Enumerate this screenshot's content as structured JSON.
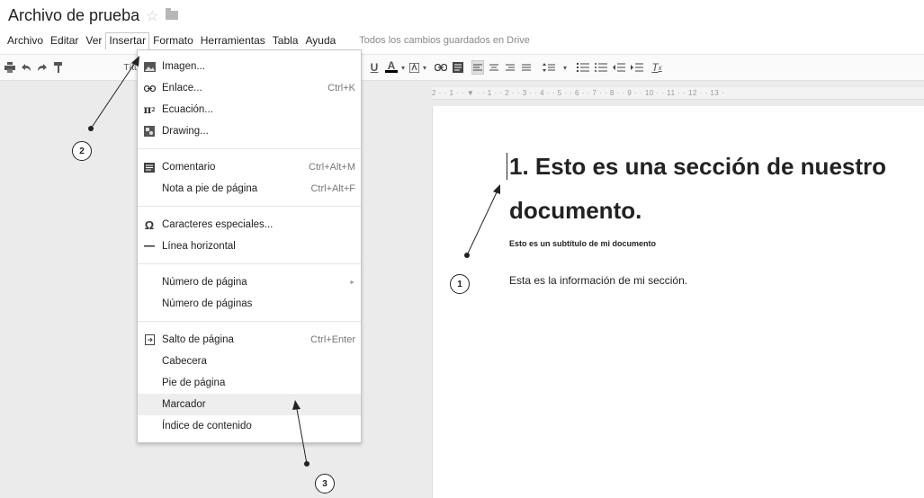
{
  "doc": {
    "title": "Archivo de prueba",
    "star_icon": "star-icon",
    "folder_icon": "folder-icon"
  },
  "menubar": {
    "items": [
      "Archivo",
      "Editar",
      "Ver",
      "Insertar",
      "Formato",
      "Herramientas",
      "Tabla",
      "Ayuda"
    ],
    "active": "Insertar",
    "saved_status": "Todos los cambios guardados en Drive"
  },
  "toolbar": {
    "style_label": "Títu",
    "icons": [
      "print-icon",
      "undo-icon",
      "redo-icon",
      "paint-format-icon",
      "underline-icon",
      "text-color-icon",
      "highlight-icon",
      "link-icon",
      "comment-icon",
      "align-left-icon",
      "align-center-icon",
      "align-right-icon",
      "justify-icon",
      "line-spacing-icon",
      "numbered-list-icon",
      "bulleted-list-icon",
      "decrease-indent-icon",
      "increase-indent-icon",
      "clear-formatting-icon"
    ]
  },
  "ruler": {
    "marks": "2 · · 1 · · ▼ · · 1 · · 2 · · 3 · · 4 · · 5 · · 6 · · 7 · · 8 · · 9 · · 10 · · 11 · · 12 · · 13 ·"
  },
  "insert_menu": {
    "items": [
      {
        "label": "Imagen...",
        "shortcut": "",
        "icon": "image-icon"
      },
      {
        "label": "Enlace...",
        "shortcut": "Ctrl+K",
        "icon": "link-icon"
      },
      {
        "label": "Ecuación...",
        "shortcut": "",
        "icon": "pi-icon"
      },
      {
        "label": "Drawing...",
        "shortcut": "",
        "icon": "drawing-icon"
      },
      {
        "label": "Comentario",
        "shortcut": "Ctrl+Alt+M",
        "icon": "comment-icon"
      },
      {
        "label": "Nota a pie de página",
        "shortcut": "Ctrl+Alt+F",
        "icon": ""
      },
      {
        "label": "Caracteres especiales...",
        "shortcut": "",
        "icon": "omega-icon"
      },
      {
        "label": "Línea horizontal",
        "shortcut": "",
        "icon": "horizontal-line-icon"
      },
      {
        "label": "Número de página",
        "shortcut": "►",
        "icon": ""
      },
      {
        "label": "Número de páginas",
        "shortcut": "",
        "icon": ""
      },
      {
        "label": "Salto de página",
        "shortcut": "Ctrl+Enter",
        "icon": "page-break-icon"
      },
      {
        "label": "Cabecera",
        "shortcut": "",
        "icon": ""
      },
      {
        "label": "Pie de página",
        "shortcut": "",
        "icon": ""
      },
      {
        "label": "Marcador",
        "shortcut": "",
        "icon": ""
      },
      {
        "label": "Índice de contenido",
        "shortcut": "",
        "icon": ""
      }
    ],
    "highlighted": "Marcador"
  },
  "document": {
    "heading_line1": "1. Esto es una sección de nuestro",
    "heading_line2": "documento.",
    "subtitle": "Esto es un subtítulo de mi documento",
    "paragraph": "Esta es la información de mi sección."
  },
  "callouts": [
    "1",
    "2",
    "3"
  ]
}
